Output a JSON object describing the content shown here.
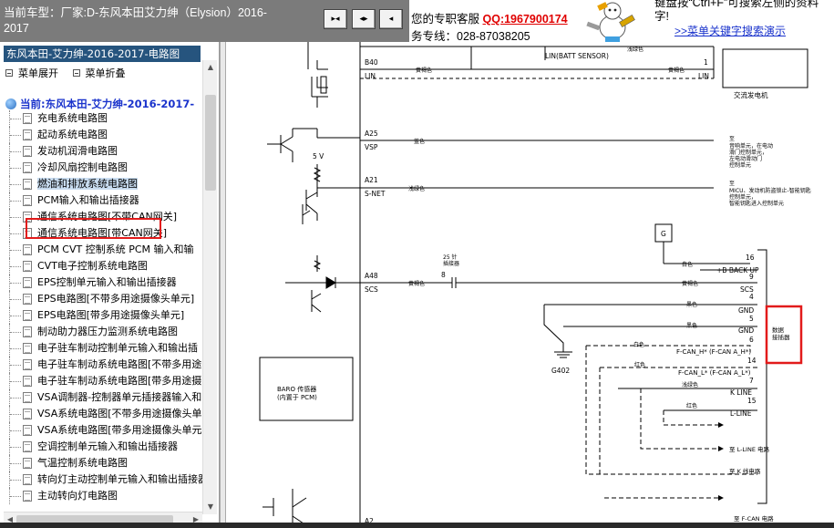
{
  "header": {
    "vehicle_line1": "当前车型：厂家:D-东风本田艾力绅（Elysion）2016-",
    "vehicle_line2": "2017",
    "service_line1": "您的专职客服",
    "qq": "QQ:1967900174",
    "service_line2": "务专线：028-87038205",
    "tip_line1": "键盘按“Ctrl+F”可搜索左侧的资料",
    "tip_line2": "字!",
    "tip_link": ">>菜单关键字搜索演示"
  },
  "sidebar": {
    "title": "东风本田-艾力绅-2016-2017-电路图",
    "expand_label": "菜单展开",
    "collapse_label": "菜单折叠",
    "current_label": "当前:东风本田-艾力绅-2016-2017-",
    "items": [
      {
        "label": "充电系统电路图"
      },
      {
        "label": "起动系统电路图"
      },
      {
        "label": "发动机润滑电路图"
      },
      {
        "label": "冷却风扇控制电路图"
      },
      {
        "label": "燃油和排放系统电路图"
      },
      {
        "label": "PCM输入和输出插接器"
      },
      {
        "label": "通信系统电路图[不带CAN网关]"
      },
      {
        "label": "通信系统电路图[带CAN网关]"
      },
      {
        "label": "PCM CVT 控制系统 PCM 输入和输"
      },
      {
        "label": "CVT电子控制系统电路图"
      },
      {
        "label": "EPS控制单元输入和输出插接器"
      },
      {
        "label": "EPS电路图[不带多用途摄像头单元]"
      },
      {
        "label": "EPS电路图[带多用途摄像头单元]"
      },
      {
        "label": "制动助力器压力监测系统电路图"
      },
      {
        "label": "电子驻车制动控制单元输入和输出插"
      },
      {
        "label": "电子驻车制动系统电路图[不带多用途"
      },
      {
        "label": "电子驻车制动系统电路图[带多用途摄"
      },
      {
        "label": "VSA调制器-控制器单元插接器输入和"
      },
      {
        "label": "VSA系统电路图[不带多用途摄像头单"
      },
      {
        "label": "VSA系统电路图[带多用途摄像头单元"
      },
      {
        "label": "空调控制单元输入和输出插接器"
      },
      {
        "label": "气温控制系统电路图"
      },
      {
        "label": "转向灯主动控制单元输入和输出插接器"
      },
      {
        "label": "主动转向灯电路图"
      }
    ]
  },
  "diagram": {
    "labels": {
      "b40": "B40",
      "lin": "LIN",
      "lin_batt": "LIN(BATT SENSOR)",
      "pin1": "1",
      "lin_right": "LIN",
      "alternator": "交流发电机",
      "a25": "A25",
      "vsp": "VSP",
      "blue": "蓝色",
      "vsp_dest1": "至",
      "vsp_dest2": "音响单元，在电动",
      "vsp_dest3": "滑门控制单元，",
      "vsp_dest4": "左电动滑动门",
      "vsp_dest5": "控制单元",
      "five_v": "5 V",
      "a21": "A21",
      "snet": "S-NET",
      "light_green": "浅绿色",
      "snet_dest1": "至",
      "snet_dest2": "MICU、发动机防盗锁止-智能钥匙",
      "snet_dest3": "控制单元，",
      "snet_dest4": "智能钥匙进入控制单元",
      "g_box": "G",
      "white": "白色",
      "pin16": "16",
      "backup": "+B BACK UP",
      "pin9": "9",
      "connector25_1": "25 针",
      "connector25_2": "插接器",
      "pin8": "8",
      "a48": "A48",
      "scs": "SCS",
      "yellow_green": "黄褐色",
      "yellow_green2": "黄褐色",
      "scs_right": "SCS",
      "pin4": "4",
      "black1": "黑色",
      "gnd1": "GND",
      "pin5": "5",
      "black2": "黑色",
      "gnd2": "GND",
      "pin6": "6",
      "dlc1": "数据",
      "dlc2": "接插器",
      "white2": "白色",
      "fcan_h": "F-CAN_H* (F-CAN A_H*)",
      "pin14": "14",
      "red": "红色",
      "fcan_l": "F-CAN_L* (F-CAN A_L*)",
      "pin7": "7",
      "light_green2": "浅绿色",
      "kline": "K LINE",
      "pin15": "15",
      "red2": "红色",
      "lline": "L-LINE",
      "g402": "G402",
      "baro1": "BARO 传感器",
      "baro2": "(内置于 PCM)",
      "to_lline": "至 L-LINE 电路",
      "to_k": "至 K 线电路",
      "to_fcan": "至 F-CAN 电路",
      "yellow_brown_top": "黄褐色",
      "light_green_top": "浅绿色",
      "a2": "A2"
    }
  }
}
